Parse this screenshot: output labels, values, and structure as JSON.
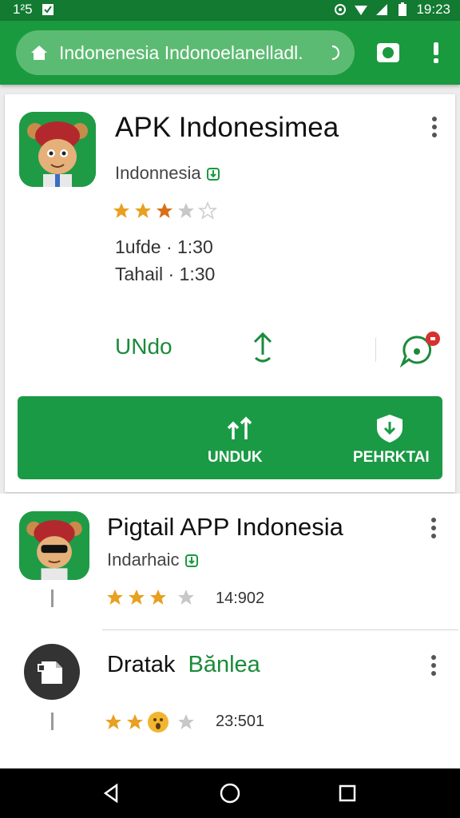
{
  "status_bar": {
    "left_text": "1²5",
    "time": "19:23"
  },
  "toolbar": {
    "url": "Indonenesia Indonoelanelladl."
  },
  "main_app": {
    "title": "APK Indonesimea",
    "developer": "Indonnesia",
    "rating": 3,
    "meta_1": "1ufde ·  1:30",
    "meta_2": "Tahail ·  1:30",
    "undo_label": "UNdo",
    "download_label": "UNDUK",
    "notify_label": "PEHRKTAI"
  },
  "list": [
    {
      "title": "Pigtail APP Indonesia",
      "developer": "Indarhaic",
      "rating_text": "14:902"
    },
    {
      "title_a": "Dratak",
      "title_b": "Bănlea",
      "rating_text": "23:501"
    }
  ],
  "colors": {
    "primary": "#1a9a3e",
    "primary_dark": "#127a31",
    "star": "#e8a020",
    "star_empty": "#c8c8c8"
  }
}
